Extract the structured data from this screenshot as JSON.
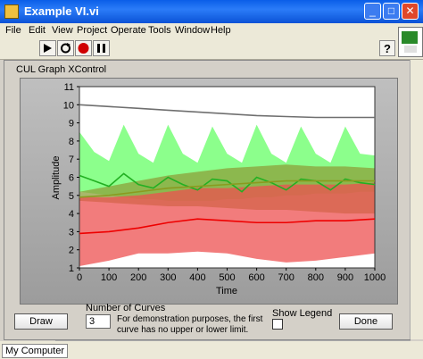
{
  "window": {
    "title": "Example VI.vi",
    "min": "_",
    "max": "□",
    "close": "✕"
  },
  "menu": [
    "File",
    "Edit",
    "View",
    "Project",
    "Operate",
    "Tools",
    "Window",
    "Help"
  ],
  "graph": {
    "label": "CUL Graph XControl"
  },
  "chart_data": {
    "type": "line",
    "xlabel": "Time",
    "ylabel": "Amplitude",
    "xlim": [
      0,
      1000
    ],
    "ylim": [
      1,
      11
    ],
    "x_ticks": [
      0,
      100,
      200,
      300,
      400,
      500,
      600,
      700,
      800,
      900,
      1000
    ],
    "y_ticks": [
      1,
      2,
      3,
      4,
      5,
      6,
      7,
      8,
      9,
      10,
      11
    ],
    "series": [
      {
        "color": "#6f6f6f",
        "band": null,
        "x": [
          0,
          100,
          200,
          300,
          400,
          500,
          600,
          700,
          800,
          900,
          1000
        ],
        "y": [
          10.0,
          9.9,
          9.8,
          9.7,
          9.6,
          9.5,
          9.4,
          9.35,
          9.3,
          9.3,
          9.3
        ]
      },
      {
        "color": "#22b022",
        "band_color": "#66ff66",
        "x": [
          0,
          50,
          100,
          150,
          200,
          250,
          300,
          350,
          400,
          450,
          500,
          550,
          600,
          650,
          700,
          750,
          800,
          850,
          900,
          950,
          1000
        ],
        "y": [
          6.1,
          5.8,
          5.5,
          6.2,
          5.6,
          5.4,
          6.0,
          5.6,
          5.3,
          5.9,
          5.8,
          5.2,
          6.0,
          5.7,
          5.3,
          5.9,
          5.8,
          5.3,
          5.9,
          5.7,
          5.6
        ],
        "upper": [
          8.5,
          7.4,
          6.9,
          8.9,
          7.3,
          6.8,
          8.9,
          7.3,
          6.8,
          8.8,
          7.3,
          6.8,
          8.9,
          7.3,
          6.8,
          8.8,
          7.3,
          6.8,
          8.8,
          7.3,
          7.2
        ],
        "lower": [
          5.2,
          5.1,
          5.0,
          4.9,
          4.8,
          4.8,
          4.7,
          4.7,
          4.7,
          4.7,
          4.8,
          4.8,
          4.9,
          4.9,
          5.0,
          5.0,
          5.1,
          5.1,
          5.1,
          5.2,
          5.2
        ]
      },
      {
        "color": "#8a9a20",
        "band_color": "#8ca03a",
        "x": [
          0,
          100,
          200,
          300,
          400,
          500,
          600,
          700,
          800,
          900,
          1000
        ],
        "y": [
          4.9,
          5.0,
          5.2,
          5.4,
          5.5,
          5.6,
          5.7,
          5.8,
          5.8,
          5.8,
          5.8
        ],
        "upper": [
          5.2,
          5.5,
          5.8,
          6.1,
          6.3,
          6.5,
          6.6,
          6.7,
          6.6,
          6.6,
          6.5
        ],
        "lower": [
          4.7,
          4.6,
          4.5,
          4.4,
          4.4,
          4.3,
          4.2,
          4.2,
          4.1,
          4.0,
          4.0
        ]
      },
      {
        "color": "#ee0000",
        "band_color": "#ee5050",
        "x": [
          0,
          100,
          200,
          300,
          400,
          500,
          600,
          700,
          800,
          900,
          1000
        ],
        "y": [
          2.9,
          3.0,
          3.2,
          3.5,
          3.7,
          3.6,
          3.5,
          3.5,
          3.6,
          3.6,
          3.7
        ],
        "upper": [
          4.9,
          4.9,
          5.0,
          5.2,
          5.4,
          5.4,
          5.5,
          5.6,
          5.6,
          5.6,
          5.7
        ],
        "lower": [
          1.1,
          1.4,
          1.8,
          1.8,
          1.9,
          1.8,
          1.5,
          1.3,
          1.4,
          1.6,
          1.8
        ]
      }
    ]
  },
  "controls": {
    "draw": "Draw",
    "done": "Done",
    "num_curves_label": "Number of Curves",
    "num_curves_value": "3",
    "note_line1": "For demonstration purposes, the first",
    "note_line2": "curve has no upper or lower limit.",
    "show_legend": "Show Legend"
  },
  "status": {
    "location": "My Computer"
  }
}
